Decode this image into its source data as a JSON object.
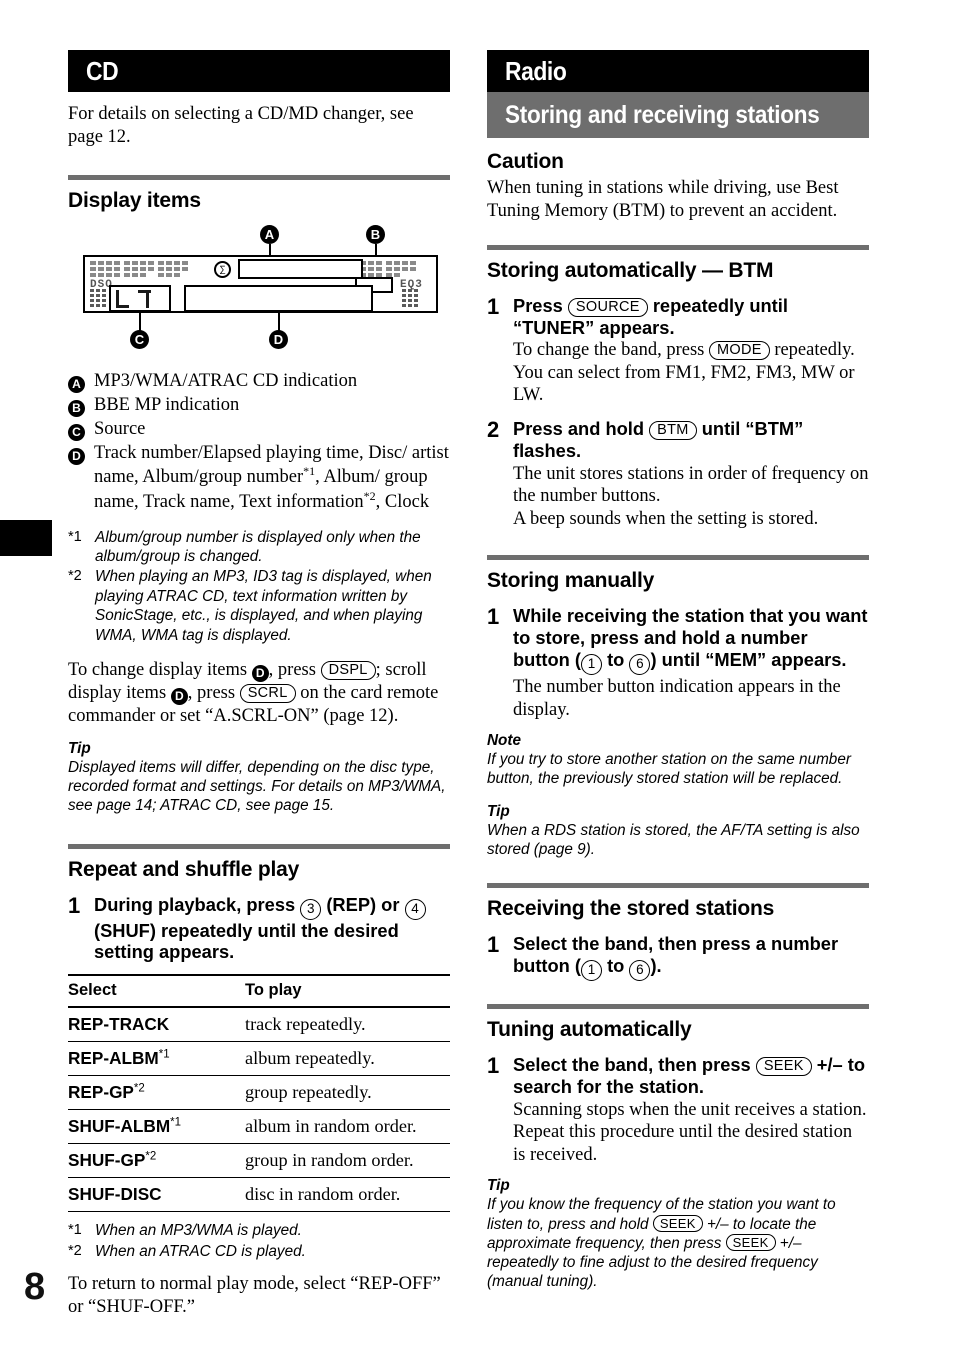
{
  "page": {
    "number": "8"
  },
  "left": {
    "banner": "CD",
    "intro": "For details on selecting a CD/MD changer, see page 12.",
    "display_items": {
      "heading": "Display items",
      "diagram": {
        "callouts": [
          "A",
          "B",
          "C",
          "D"
        ],
        "lcd_left_label": "DSO",
        "lcd_right_label": "EQ3"
      },
      "legend": [
        {
          "key": "A",
          "text": "MP3/WMA/ATRAC CD indication"
        },
        {
          "key": "B",
          "text": "BBE MP indication"
        },
        {
          "key": "C",
          "text": "Source"
        },
        {
          "key": "D",
          "text": "Track number/Elapsed playing time, Disc/artist name, Album/group number*1, Album/group name, Track name, Text information*2, Clock"
        }
      ],
      "footnotes": [
        {
          "mark": "*1",
          "text": "Album/group number is displayed only when the album/group is changed."
        },
        {
          "mark": "*2",
          "text": "When playing an MP3, ID3 tag is displayed, when playing ATRAC CD, text information written by SonicStage, etc., is displayed, and when playing WMA, WMA tag is displayed."
        }
      ],
      "change_paragraph": {
        "p1": "To change display items ",
        "p2": ", press ",
        "btn1": "DSPL",
        "p3": "; scroll display items ",
        "p4": ", press ",
        "btn2": "SCRL",
        "p5": " on the card remote commander or set “A.SCRL-ON” (page 12)."
      },
      "tip_label": "Tip",
      "tip_text": "Displayed items will differ, depending on the disc type, recorded format and settings. For details on MP3/WMA, see page 14; ATRAC CD, see page 15."
    },
    "repeat_shuffle": {
      "heading": "Repeat and shuffle play",
      "step1": {
        "num": "1",
        "a": "During playback, press ",
        "btn_rep": "3",
        "b": " (REP) or ",
        "btn_shuf": "4",
        "c": " (SHUF) repeatedly until the desired setting appears."
      },
      "table": {
        "headers": [
          "Select",
          "To play"
        ],
        "rows": [
          {
            "select": "REP-TRACK",
            "sup": "",
            "play": "track repeatedly."
          },
          {
            "select": "REP-ALBM",
            "sup": "*1",
            "play": "album repeatedly."
          },
          {
            "select": "REP-GP",
            "sup": "*2",
            "play": "group repeatedly."
          },
          {
            "select": "SHUF-ALBM",
            "sup": "*1",
            "play": "album in random order."
          },
          {
            "select": "SHUF-GP",
            "sup": "*2",
            "play": "group in random order."
          },
          {
            "select": "SHUF-DISC",
            "sup": "",
            "play": "disc in random order."
          }
        ]
      },
      "footnotes": [
        {
          "mark": "*1",
          "text": "When an MP3/WMA is played."
        },
        {
          "mark": "*2",
          "text": "When an ATRAC CD is played."
        }
      ],
      "closing": "To return to normal play mode, select “REP-OFF” or “SHUF-OFF.”"
    }
  },
  "right": {
    "banner_black": "Radio",
    "banner_grey": "Storing and receiving stations",
    "caution": {
      "label": "Caution",
      "text": "When tuning in stations while driving, use Best Tuning Memory (BTM) to prevent an accident."
    },
    "btm": {
      "heading": "Storing automatically — BTM",
      "step1": {
        "num": "1",
        "head_a": "Press ",
        "btn": "SOURCE",
        "head_b": " repeatedly until “TUNER” appears.",
        "body_a": "To change the band, press ",
        "body_btn": "MODE",
        "body_b": " repeatedly. You can select from FM1, FM2, FM3, MW or LW."
      },
      "step2": {
        "num": "2",
        "head_a": "Press and hold ",
        "btn": "BTM",
        "head_b": " until “BTM” flashes.",
        "body": "The unit stores stations in order of frequency on the number buttons.\nA beep sounds when the setting is stored."
      }
    },
    "manual": {
      "heading": "Storing manually",
      "step1": {
        "num": "1",
        "a": "While receiving the station that you want to store, press and hold a number button (",
        "btn_from": "1",
        "b": " to ",
        "btn_to": "6",
        "c": ") until “MEM” appears.",
        "body": "The number button indication appears in the display."
      },
      "note_label": "Note",
      "note_text": "If you try to store another station on the same number button, the previously stored station will be replaced.",
      "tip_label": "Tip",
      "tip_text": "When a RDS station is stored, the AF/TA setting is also stored (page 9)."
    },
    "receiving": {
      "heading": "Receiving the stored stations",
      "step1": {
        "num": "1",
        "a": "Select the band, then press a number button (",
        "btn_from": "1",
        "b": " to ",
        "btn_to": "6",
        "c": ")."
      }
    },
    "tuning": {
      "heading": "Tuning automatically",
      "step1": {
        "num": "1",
        "a": "Select the band, then press ",
        "btn": "SEEK",
        "b": " +/– to search for the station.",
        "body": "Scanning stops when the unit receives a station. Repeat this procedure until the desired station is received."
      },
      "tip_label": "Tip",
      "tip": {
        "a": "If you know the frequency of the station you want to listen to, press and hold ",
        "btn1": "SEEK",
        "b": " +/– to locate the approximate frequency, then press ",
        "btn2": "SEEK",
        "c": " +/– repeatedly to fine adjust to the desired frequency (manual tuning)."
      }
    }
  }
}
